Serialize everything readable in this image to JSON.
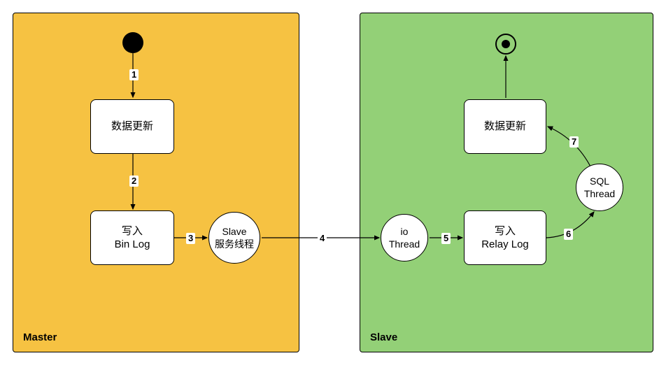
{
  "panels": {
    "master": {
      "label": "Master",
      "color": "#f6c242"
    },
    "slave": {
      "label": "Slave",
      "color": "#93d077"
    }
  },
  "nodes": {
    "start": {
      "type": "start"
    },
    "master_update": {
      "type": "rect",
      "label": "数据更新"
    },
    "write_binlog": {
      "type": "rect",
      "label": "写入\nBin Log"
    },
    "slave_svc": {
      "type": "circle",
      "label": "Slave\n服务线程"
    },
    "io_thread": {
      "type": "circle",
      "label": "io\nThread"
    },
    "write_relay": {
      "type": "rect",
      "label": "写入\nRelay Log"
    },
    "sql_thread": {
      "type": "circle",
      "label": "SQL\nThread"
    },
    "slave_update": {
      "type": "rect",
      "label": "数据更新"
    },
    "end": {
      "type": "end"
    }
  },
  "edges": {
    "e1": {
      "from": "start",
      "to": "master_update",
      "label": "1"
    },
    "e2": {
      "from": "master_update",
      "to": "write_binlog",
      "label": "2"
    },
    "e3": {
      "from": "write_binlog",
      "to": "slave_svc",
      "label": "3"
    },
    "e4": {
      "from": "slave_svc",
      "to": "io_thread",
      "label": "4"
    },
    "e5": {
      "from": "io_thread",
      "to": "write_relay",
      "label": "5"
    },
    "e6": {
      "from": "write_relay",
      "to": "sql_thread",
      "label": "6"
    },
    "e7": {
      "from": "sql_thread",
      "to": "slave_update",
      "label": "7"
    },
    "e8": {
      "from": "slave_update",
      "to": "end",
      "label": ""
    }
  }
}
